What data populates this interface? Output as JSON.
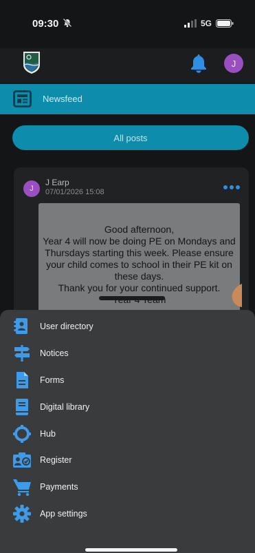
{
  "status_bar": {
    "time": "09:30",
    "network": "5G"
  },
  "header": {
    "user_initial": "J"
  },
  "newsfeed": {
    "title": "Newsfeed"
  },
  "filter": {
    "label": "All posts"
  },
  "post": {
    "author_initial": "J",
    "author": "J Earp",
    "date": "07/01/2026 15:08",
    "text": "Good afternoon,\nYear 4 will now be doing PE on Mondays and Thursdays starting this week. Please ensure your child comes to school in their PE kit on these days.\nThank you for your continued support.\nYear 4 Team"
  },
  "menu": {
    "items": [
      {
        "label": "User directory",
        "icon": "user-directory-icon"
      },
      {
        "label": "Notices",
        "icon": "notices-signpost-icon"
      },
      {
        "label": "Forms",
        "icon": "forms-document-icon"
      },
      {
        "label": "Digital library",
        "icon": "digital-library-book-icon"
      },
      {
        "label": "Hub",
        "icon": "hub-icon"
      },
      {
        "label": "Register",
        "icon": "register-icon"
      },
      {
        "label": "Payments",
        "icon": "cart-icon"
      },
      {
        "label": "App settings",
        "icon": "gear-icon"
      }
    ]
  },
  "colors": {
    "accent": "#0d8cac",
    "menu_icon": "#3d9be9",
    "avatar": "#9a4fc1",
    "sheet": "#3a3b3d"
  }
}
